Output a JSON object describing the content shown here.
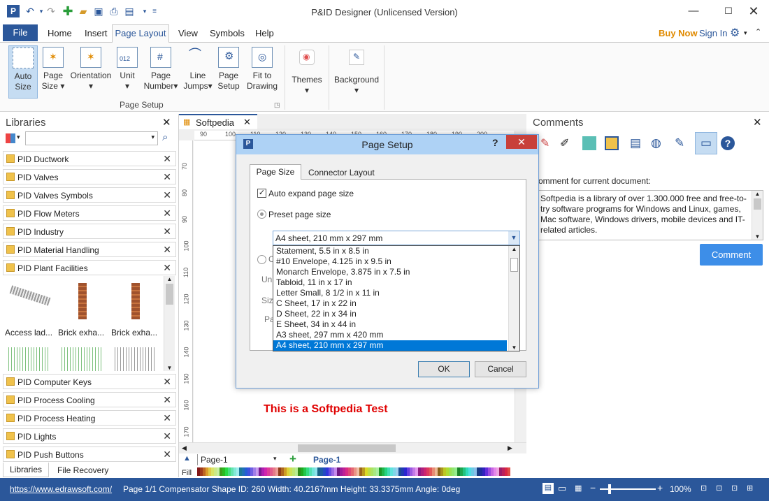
{
  "app": {
    "title": "P&ID Designer (Unlicensed Version)"
  },
  "menu": {
    "file": "File",
    "tabs": [
      "Home",
      "Insert",
      "Page Layout",
      "View",
      "Symbols",
      "Help"
    ],
    "buy_now": "Buy Now",
    "sign_in": "Sign In"
  },
  "ribbon": {
    "buttons": [
      {
        "l1": "Auto",
        "l2": "Size"
      },
      {
        "l1": "Page",
        "l2": "Size ▾"
      },
      {
        "l1": "Orientation",
        "l2": "▾"
      },
      {
        "l1": "Unit",
        "l2": "▾"
      },
      {
        "l1": "Page",
        "l2": "Number▾"
      },
      {
        "l1": "Line",
        "l2": "Jumps▾"
      },
      {
        "l1": "Page",
        "l2": "Setup"
      },
      {
        "l1": "Fit to",
        "l2": "Drawing"
      }
    ],
    "themes": "Themes",
    "background": "Background",
    "group_label": "Page Setup"
  },
  "libraries": {
    "title": "Libraries",
    "items_top": [
      "PID Ductwork",
      "PID Valves",
      "PID Valves Symbols",
      "PID Flow Meters",
      "PID Industry",
      "PID Material Handling",
      "PID Plant Facilities"
    ],
    "symbols": [
      "Access lad...",
      "Brick exha...",
      "Brick exha..."
    ],
    "items_bottom": [
      "PID Computer Keys",
      "PID Process Cooling",
      "PID Process Heating",
      "PID Lights",
      "PID Push Buttons"
    ],
    "tab_libraries": "Libraries",
    "tab_recovery": "File Recovery"
  },
  "document": {
    "tab": "Softpedia",
    "canvas_text": "This is a Softpedia Test",
    "page_select": "Page-1",
    "page_tab": "Page-1",
    "fill_label": "Fill",
    "ruler_top": [
      "90",
      "100",
      "110",
      "120",
      "130",
      "140",
      "150",
      "160",
      "170",
      "180",
      "190",
      "200"
    ],
    "ruler_left": [
      "70",
      "80",
      "90",
      "100",
      "110",
      "120",
      "130",
      "140",
      "150",
      "160",
      "170"
    ]
  },
  "dialog": {
    "title": "Page Setup",
    "help": "?",
    "tabs": [
      "Page Size",
      "Connector Layout"
    ],
    "auto_expand": "Auto expand page size",
    "preset": "Preset page size",
    "selected": "A4 sheet, 210 mm x 297 mm",
    "options": [
      "Statement, 5.5 in x 8.5 in",
      "#10 Envelope, 4.125 in x 9.5 in",
      "Monarch Envelope, 3.875 in x 7.5 in",
      "Tabloid, 11 in x 17 in",
      "Letter Small, 8 1/2 in x 11 in",
      "C Sheet, 17 in x 22 in",
      "D Sheet, 22 in x 34 in",
      "E Sheet, 34 in x 44 in",
      "A3 sheet, 297 mm x 420 mm",
      "A4 sheet, 210 mm x 297 mm"
    ],
    "hidden_labels": [
      "C",
      "Un",
      "Size",
      "Pa"
    ],
    "ok": "OK",
    "cancel": "Cancel"
  },
  "comments": {
    "title": "Comments",
    "label": "omment for current document:",
    "text": "Softpedia is a library of over 1.300.000 free and free-to-try software programs for Windows and Linux, games, Mac software, Windows drivers, mobile devices and IT-related articles.",
    "button": "Comment"
  },
  "status": {
    "url": "https://www.edrawsoft.com/",
    "info": "Page 1/1  Compensator  Shape ID: 260  Width: 40.2167mm  Height: 33.3375mm  Angle: 0deg",
    "zoom": "100%"
  }
}
